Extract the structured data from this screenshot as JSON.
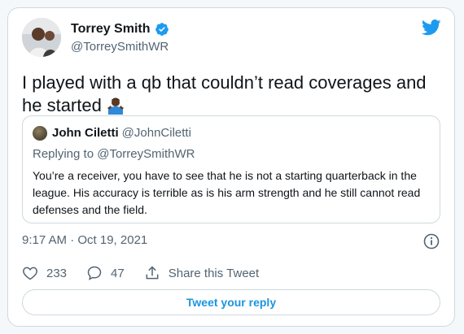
{
  "tweet": {
    "author": {
      "name": "Torrey Smith",
      "handle": "@TorreySmithWR"
    },
    "text": "I played with a qb that couldn’t read coverages and he started",
    "emoji": "man-shrugging-emoji",
    "timestamp": "9:17 AM · Oct 19, 2021"
  },
  "quote": {
    "author": {
      "name": "John Ciletti",
      "handle": "@JohnCiletti"
    },
    "replying_label": "Replying to",
    "replying_to": "@TorreySmithWR",
    "text": "You’re a receiver, you have to see that he is not a starting quarterback in the league. His accuracy is terrible as is his arm strength and he still cannot read defenses and the field."
  },
  "actions": {
    "likes": "233",
    "replies": "47",
    "share_label": "Share this Tweet"
  },
  "reply_button_label": "Tweet your reply",
  "colors": {
    "twitter_blue": "#1d9bf0",
    "link_blue": "#1b95e0",
    "border": "#cfd9de",
    "muted": "#536471"
  }
}
